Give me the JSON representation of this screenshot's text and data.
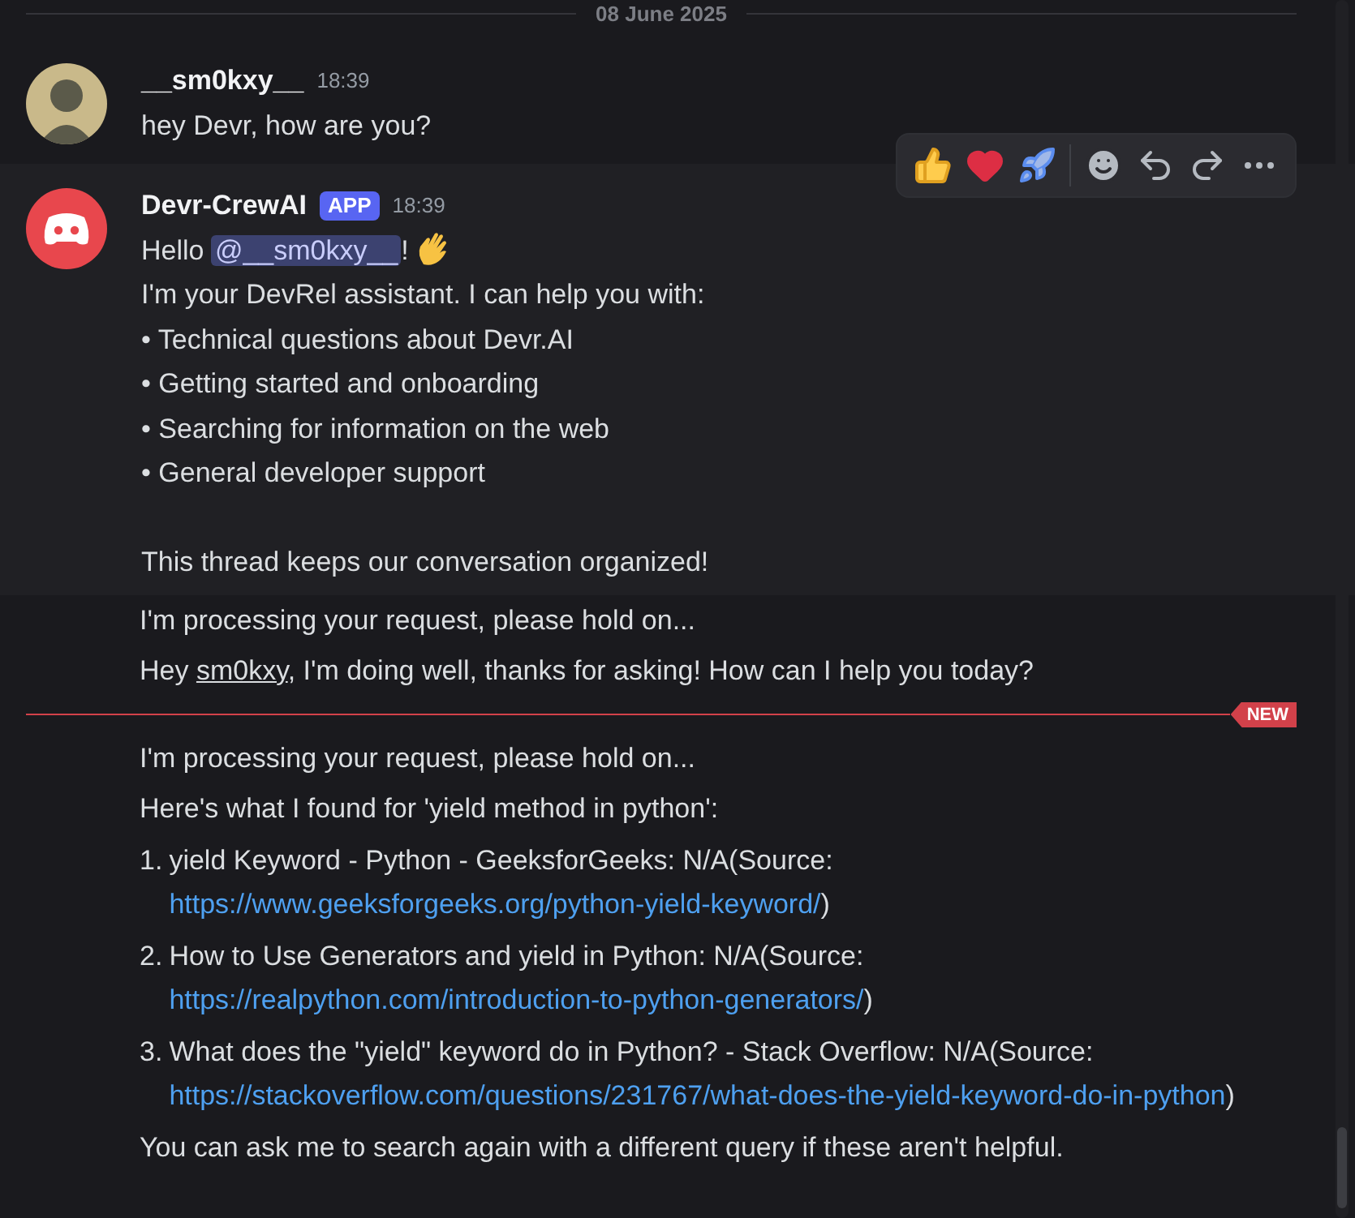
{
  "date_divider": "08 June 2025",
  "first_message": {
    "author": "__sm0kxy__",
    "time": "18:39",
    "text": "hey Devr, how are you?"
  },
  "bot_message": {
    "author": "Devr-CrewAI",
    "badge": "APP",
    "time": "18:39",
    "hovered": true,
    "greeting": "Hello ",
    "mention": "@__sm0kxy__",
    "greeting_end": "!",
    "intro": "I'm your DevRel assistant. I can help you with:",
    "bullets": [
      "• Technical questions about Devr.AI",
      "• Getting started and onboarding",
      "• Searching for information on the web",
      "• General developer support"
    ],
    "closing": "This thread keeps our conversation organized!"
  },
  "followups": [
    {
      "kind": "plain",
      "text": "I'm processing your request, please hold on..."
    },
    {
      "kind": "mention",
      "before": "Hey ",
      "mention": "sm0kxy",
      "after": ", I'm doing well, thanks for asking! How can I help you today?"
    },
    {
      "kind": "new_divider",
      "label": "NEW"
    },
    {
      "kind": "plain",
      "text": "I'm processing your request, please hold on..."
    },
    {
      "kind": "plain",
      "text": "Here's what I found for 'yield method in python':"
    },
    {
      "kind": "result",
      "number": "1.",
      "title": "yield Keyword - Python - GeeksforGeeks: N/A(Source:",
      "url": "https://www.geeksforgeeks.org/python-yield-keyword/",
      "after": ")"
    },
    {
      "kind": "result",
      "number": "2.",
      "title": "How to Use Generators and yield in Python: N/A(Source:",
      "url": "https://realpython.com/introduction-to-python-generators/",
      "after": ")"
    },
    {
      "kind": "result",
      "number": "3.",
      "title": "What does the \"yield\" keyword do in Python? - Stack Overflow: N/A(Source:",
      "url": "https://stackoverflow.com/questions/231767/what-does-the-yield-keyword-do-in-python",
      "after": ")"
    },
    {
      "kind": "plain",
      "text": "You can ask me to search again with a different query if these aren't helpful."
    }
  ]
}
